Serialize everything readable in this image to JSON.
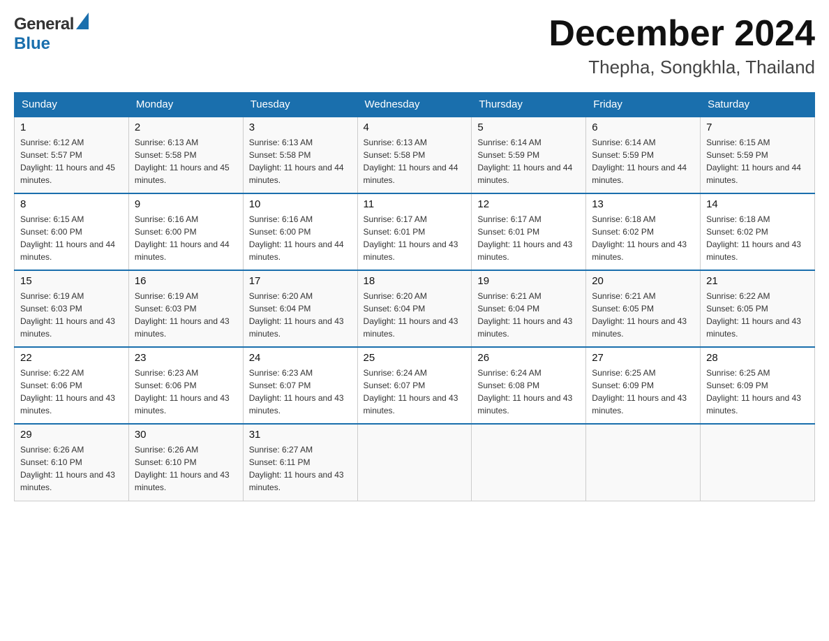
{
  "header": {
    "logo_general": "General",
    "logo_blue": "Blue",
    "month_title": "December 2024",
    "location": "Thepha, Songkhla, Thailand"
  },
  "days_of_week": [
    "Sunday",
    "Monday",
    "Tuesday",
    "Wednesday",
    "Thursday",
    "Friday",
    "Saturday"
  ],
  "weeks": [
    [
      {
        "day": "1",
        "sunrise": "Sunrise: 6:12 AM",
        "sunset": "Sunset: 5:57 PM",
        "daylight": "Daylight: 11 hours and 45 minutes."
      },
      {
        "day": "2",
        "sunrise": "Sunrise: 6:13 AM",
        "sunset": "Sunset: 5:58 PM",
        "daylight": "Daylight: 11 hours and 45 minutes."
      },
      {
        "day": "3",
        "sunrise": "Sunrise: 6:13 AM",
        "sunset": "Sunset: 5:58 PM",
        "daylight": "Daylight: 11 hours and 44 minutes."
      },
      {
        "day": "4",
        "sunrise": "Sunrise: 6:13 AM",
        "sunset": "Sunset: 5:58 PM",
        "daylight": "Daylight: 11 hours and 44 minutes."
      },
      {
        "day": "5",
        "sunrise": "Sunrise: 6:14 AM",
        "sunset": "Sunset: 5:59 PM",
        "daylight": "Daylight: 11 hours and 44 minutes."
      },
      {
        "day": "6",
        "sunrise": "Sunrise: 6:14 AM",
        "sunset": "Sunset: 5:59 PM",
        "daylight": "Daylight: 11 hours and 44 minutes."
      },
      {
        "day": "7",
        "sunrise": "Sunrise: 6:15 AM",
        "sunset": "Sunset: 5:59 PM",
        "daylight": "Daylight: 11 hours and 44 minutes."
      }
    ],
    [
      {
        "day": "8",
        "sunrise": "Sunrise: 6:15 AM",
        "sunset": "Sunset: 6:00 PM",
        "daylight": "Daylight: 11 hours and 44 minutes."
      },
      {
        "day": "9",
        "sunrise": "Sunrise: 6:16 AM",
        "sunset": "Sunset: 6:00 PM",
        "daylight": "Daylight: 11 hours and 44 minutes."
      },
      {
        "day": "10",
        "sunrise": "Sunrise: 6:16 AM",
        "sunset": "Sunset: 6:00 PM",
        "daylight": "Daylight: 11 hours and 44 minutes."
      },
      {
        "day": "11",
        "sunrise": "Sunrise: 6:17 AM",
        "sunset": "Sunset: 6:01 PM",
        "daylight": "Daylight: 11 hours and 43 minutes."
      },
      {
        "day": "12",
        "sunrise": "Sunrise: 6:17 AM",
        "sunset": "Sunset: 6:01 PM",
        "daylight": "Daylight: 11 hours and 43 minutes."
      },
      {
        "day": "13",
        "sunrise": "Sunrise: 6:18 AM",
        "sunset": "Sunset: 6:02 PM",
        "daylight": "Daylight: 11 hours and 43 minutes."
      },
      {
        "day": "14",
        "sunrise": "Sunrise: 6:18 AM",
        "sunset": "Sunset: 6:02 PM",
        "daylight": "Daylight: 11 hours and 43 minutes."
      }
    ],
    [
      {
        "day": "15",
        "sunrise": "Sunrise: 6:19 AM",
        "sunset": "Sunset: 6:03 PM",
        "daylight": "Daylight: 11 hours and 43 minutes."
      },
      {
        "day": "16",
        "sunrise": "Sunrise: 6:19 AM",
        "sunset": "Sunset: 6:03 PM",
        "daylight": "Daylight: 11 hours and 43 minutes."
      },
      {
        "day": "17",
        "sunrise": "Sunrise: 6:20 AM",
        "sunset": "Sunset: 6:04 PM",
        "daylight": "Daylight: 11 hours and 43 minutes."
      },
      {
        "day": "18",
        "sunrise": "Sunrise: 6:20 AM",
        "sunset": "Sunset: 6:04 PM",
        "daylight": "Daylight: 11 hours and 43 minutes."
      },
      {
        "day": "19",
        "sunrise": "Sunrise: 6:21 AM",
        "sunset": "Sunset: 6:04 PM",
        "daylight": "Daylight: 11 hours and 43 minutes."
      },
      {
        "day": "20",
        "sunrise": "Sunrise: 6:21 AM",
        "sunset": "Sunset: 6:05 PM",
        "daylight": "Daylight: 11 hours and 43 minutes."
      },
      {
        "day": "21",
        "sunrise": "Sunrise: 6:22 AM",
        "sunset": "Sunset: 6:05 PM",
        "daylight": "Daylight: 11 hours and 43 minutes."
      }
    ],
    [
      {
        "day": "22",
        "sunrise": "Sunrise: 6:22 AM",
        "sunset": "Sunset: 6:06 PM",
        "daylight": "Daylight: 11 hours and 43 minutes."
      },
      {
        "day": "23",
        "sunrise": "Sunrise: 6:23 AM",
        "sunset": "Sunset: 6:06 PM",
        "daylight": "Daylight: 11 hours and 43 minutes."
      },
      {
        "day": "24",
        "sunrise": "Sunrise: 6:23 AM",
        "sunset": "Sunset: 6:07 PM",
        "daylight": "Daylight: 11 hours and 43 minutes."
      },
      {
        "day": "25",
        "sunrise": "Sunrise: 6:24 AM",
        "sunset": "Sunset: 6:07 PM",
        "daylight": "Daylight: 11 hours and 43 minutes."
      },
      {
        "day": "26",
        "sunrise": "Sunrise: 6:24 AM",
        "sunset": "Sunset: 6:08 PM",
        "daylight": "Daylight: 11 hours and 43 minutes."
      },
      {
        "day": "27",
        "sunrise": "Sunrise: 6:25 AM",
        "sunset": "Sunset: 6:09 PM",
        "daylight": "Daylight: 11 hours and 43 minutes."
      },
      {
        "day": "28",
        "sunrise": "Sunrise: 6:25 AM",
        "sunset": "Sunset: 6:09 PM",
        "daylight": "Daylight: 11 hours and 43 minutes."
      }
    ],
    [
      {
        "day": "29",
        "sunrise": "Sunrise: 6:26 AM",
        "sunset": "Sunset: 6:10 PM",
        "daylight": "Daylight: 11 hours and 43 minutes."
      },
      {
        "day": "30",
        "sunrise": "Sunrise: 6:26 AM",
        "sunset": "Sunset: 6:10 PM",
        "daylight": "Daylight: 11 hours and 43 minutes."
      },
      {
        "day": "31",
        "sunrise": "Sunrise: 6:27 AM",
        "sunset": "Sunset: 6:11 PM",
        "daylight": "Daylight: 11 hours and 43 minutes."
      },
      null,
      null,
      null,
      null
    ]
  ]
}
